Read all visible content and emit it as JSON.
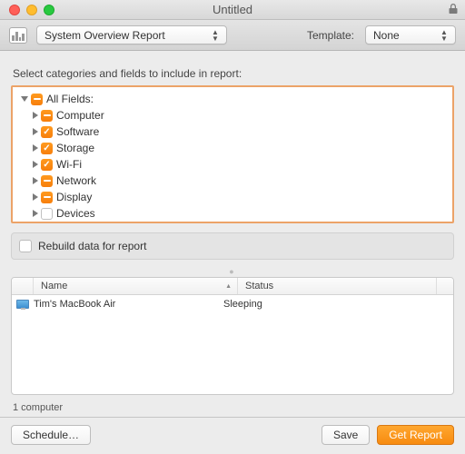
{
  "window": {
    "title": "Untitled"
  },
  "toolbar": {
    "report_selector": "System Overview Report",
    "template_label": "Template:",
    "template_value": "None"
  },
  "instruction": "Select categories and fields to include in report:",
  "categories": {
    "root": "All Fields:",
    "items": [
      {
        "label": "Computer",
        "state": "mixed"
      },
      {
        "label": "Software",
        "state": "checked"
      },
      {
        "label": "Storage",
        "state": "checked"
      },
      {
        "label": "Wi-Fi",
        "state": "checked"
      },
      {
        "label": "Network",
        "state": "mixed"
      },
      {
        "label": "Display",
        "state": "mixed"
      },
      {
        "label": "Devices",
        "state": "unchecked"
      }
    ]
  },
  "rebuild_label": "Rebuild data for report",
  "table": {
    "columns": {
      "name": "Name",
      "status": "Status"
    },
    "rows": [
      {
        "name": "Tim's MacBook Air",
        "status": "Sleeping"
      }
    ]
  },
  "count_label": "1 computer",
  "buttons": {
    "schedule": "Schedule…",
    "save": "Save",
    "get_report": "Get Report"
  }
}
